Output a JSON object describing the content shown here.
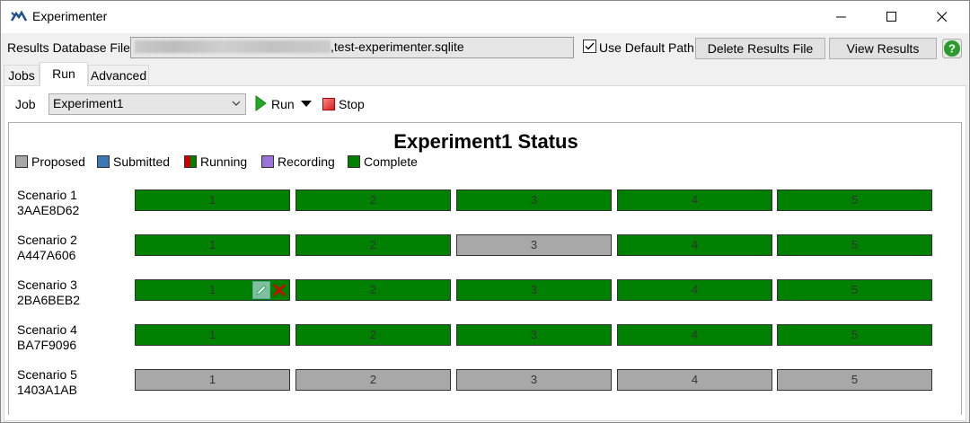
{
  "window": {
    "title": "Experimenter",
    "minimize_icon": "minimize-icon",
    "maximize_icon": "maximize-icon",
    "close_icon": "close-icon"
  },
  "results": {
    "label": "Results Database File",
    "path_visible": "test-experimenter.sqlite",
    "path_prefix": ",",
    "use_default_path_label": "Use Default Path",
    "use_default_path_checked": true,
    "delete_button": "Delete Results File",
    "view_button": "View Results",
    "help_icon": "help-icon"
  },
  "tabs": [
    {
      "label": "Jobs",
      "active": false
    },
    {
      "label": "Run",
      "active": true
    },
    {
      "label": "Advanced",
      "active": false
    }
  ],
  "job": {
    "label": "Job",
    "selected": "Experiment1",
    "run_label": "Run",
    "stop_label": "Stop"
  },
  "status": {
    "title": "Experiment1 Status",
    "legend": [
      {
        "label": "Proposed",
        "color": "#a8a8a8"
      },
      {
        "label": "Submitted",
        "color": "#3b78b5"
      },
      {
        "label": "Running",
        "color": "#cc0000"
      },
      {
        "label": "Recording",
        "color": "#9b72d9"
      },
      {
        "label": "Complete",
        "color": "#008000"
      }
    ],
    "scenarios": [
      {
        "name": "Scenario 1",
        "id": "3AAE8D62",
        "runs": [
          {
            "label": "1",
            "state": "complete"
          },
          {
            "label": "2",
            "state": "complete"
          },
          {
            "label": "3",
            "state": "complete"
          },
          {
            "label": "4",
            "state": "complete"
          },
          {
            "label": "5",
            "state": "complete"
          }
        ]
      },
      {
        "name": "Scenario 2",
        "id": "A447A606",
        "runs": [
          {
            "label": "1",
            "state": "complete"
          },
          {
            "label": "2",
            "state": "complete"
          },
          {
            "label": "3",
            "state": "proposed"
          },
          {
            "label": "4",
            "state": "complete"
          },
          {
            "label": "5",
            "state": "complete"
          }
        ]
      },
      {
        "name": "Scenario 3",
        "id": "2BA6BEB2",
        "runs": [
          {
            "label": "1",
            "state": "complete"
          },
          {
            "label": "2",
            "state": "complete"
          },
          {
            "label": "3",
            "state": "complete"
          },
          {
            "label": "4",
            "state": "complete"
          },
          {
            "label": "5",
            "state": "complete"
          }
        ]
      },
      {
        "name": "Scenario 4",
        "id": "BA7F9096",
        "runs": [
          {
            "label": "1",
            "state": "complete"
          },
          {
            "label": "2",
            "state": "complete"
          },
          {
            "label": "3",
            "state": "complete"
          },
          {
            "label": "4",
            "state": "complete"
          },
          {
            "label": "5",
            "state": "complete"
          }
        ]
      },
      {
        "name": "Scenario 5",
        "id": "1403A1AB",
        "runs": [
          {
            "label": "1",
            "state": "proposed"
          },
          {
            "label": "2",
            "state": "proposed"
          },
          {
            "label": "3",
            "state": "proposed"
          },
          {
            "label": "4",
            "state": "proposed"
          },
          {
            "label": "5",
            "state": "proposed"
          }
        ]
      }
    ],
    "hover_tools": [
      "edit-icon",
      "delete-icon"
    ]
  }
}
